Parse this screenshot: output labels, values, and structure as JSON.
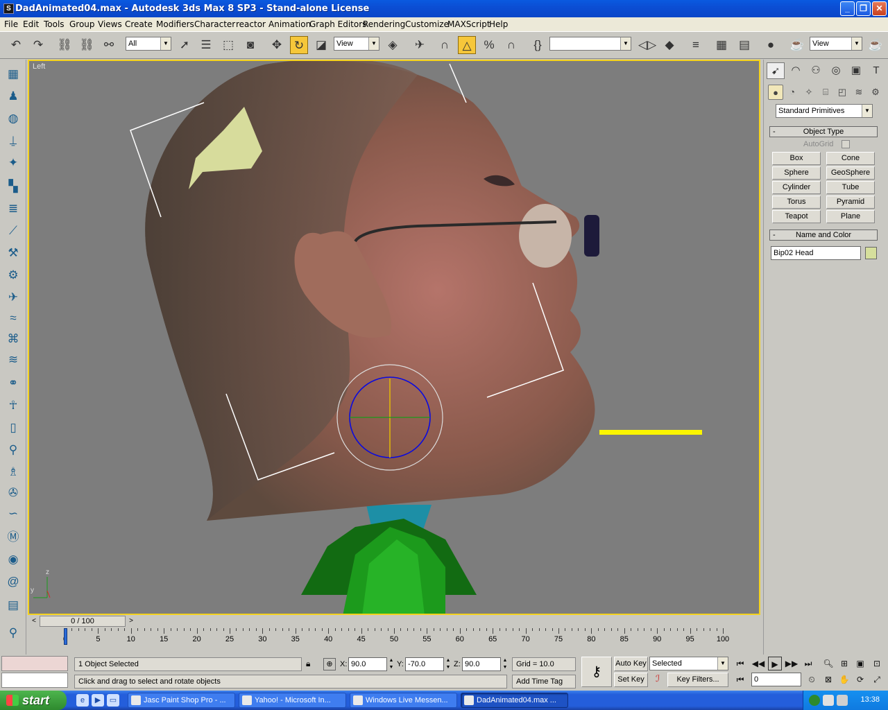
{
  "window": {
    "title": "DadAnimated04.max - Autodesk 3ds Max 8 SP3  - Stand-alone License",
    "minimize": "_",
    "maximize": "❐",
    "close": "✕"
  },
  "menu": [
    "File",
    "Edit",
    "Tools",
    "Group",
    "Views",
    "Create",
    "Modifiers",
    "Character",
    "reactor",
    "Animation",
    "Graph Editors",
    "Rendering",
    "Customize",
    "MAXScript",
    "Help"
  ],
  "toolbar": {
    "selection_filter": "All",
    "ref_coord": "View",
    "named_selection": "",
    "render_view": "View"
  },
  "viewport": {
    "label": "Left",
    "axis_z": "z",
    "axis_y": "y"
  },
  "command_panel": {
    "category": "Standard Primitives",
    "object_type_title": "Object Type",
    "autogrid": "AutoGrid",
    "buttons": [
      "Box",
      "Cone",
      "Sphere",
      "GeoSphere",
      "Cylinder",
      "Tube",
      "Torus",
      "Pyramid",
      "Teapot",
      "Plane"
    ],
    "name_color_title": "Name and Color",
    "object_name": "Bip02 Head",
    "object_color": "#d6df9c",
    "rollout_toggle": "-"
  },
  "timeline": {
    "frame_display": "0 / 100",
    "ticks": [
      "0",
      "5",
      "10",
      "15",
      "20",
      "25",
      "30",
      "35",
      "40",
      "45",
      "50",
      "55",
      "60",
      "65",
      "70",
      "75",
      "80",
      "85",
      "90",
      "95",
      "100"
    ],
    "current_frame": "0"
  },
  "status": {
    "selection": "1 Object Selected",
    "prompt": "Click and drag to select and rotate objects",
    "x_label": "X:",
    "x_value": "90.0",
    "y_label": "Y:",
    "y_value": "-70.0",
    "z_label": "Z:",
    "z_value": "90.0",
    "grid": "Grid = 10.0",
    "add_time_tag": "Add Time Tag",
    "auto_key": "Auto Key",
    "set_key": "Set Key",
    "key_mode": "Selected",
    "key_filters": "Key Filters..."
  },
  "taskbar": {
    "start": "start",
    "tasks": [
      "Jasc Paint Shop Pro - ...",
      "Yahoo! - Microsoft In...",
      "Windows Live Messen...",
      "DadAnimated04.max ..."
    ],
    "clock": "13:38"
  },
  "colors": {
    "viewport_bg": "#7d7d7d",
    "active_border": "#f4d21e",
    "title_blue": "#0b4ed4",
    "active_tool": "#f6c73a"
  }
}
